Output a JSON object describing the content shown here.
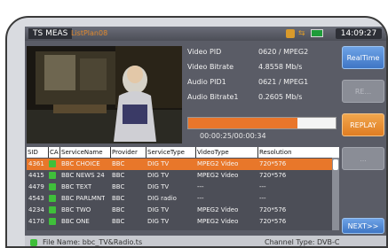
{
  "topbar": {
    "meas_tab": "TS MEAS",
    "list_tab": "ListPlan08",
    "clock": "14:09:27",
    "icons": [
      "satellite-signal-icon",
      "network-icon",
      "battery-icon"
    ]
  },
  "info": {
    "rows": [
      {
        "label": "Video PID",
        "value": "0620 / MPEG2"
      },
      {
        "label": "Video Bitrate",
        "value": "4.8558 Mb/s"
      },
      {
        "label": "Audio PID1",
        "value": "0621 / MPEG1"
      },
      {
        "label": "Audio Bitrate1",
        "value": "0.2605 Mb/s"
      }
    ]
  },
  "playback": {
    "time": "00:00:25/00:00:34",
    "progress_fraction": 0.74
  },
  "side_buttons": {
    "realtime": "RealTime",
    "disabled1": "RE...",
    "replay": "REPLAY",
    "disabled2": "..."
  },
  "table": {
    "columns": [
      "SID",
      "CA",
      "ServiceName",
      "Provider",
      "ServiceType",
      "VideoType",
      "Resolution"
    ],
    "rows": [
      {
        "sid": "4361",
        "service": "BBC CHOICE",
        "provider": "BBC",
        "type": "DIG TV",
        "video": "MPEG2 Video",
        "res": "720*576",
        "selected": true
      },
      {
        "sid": "4415",
        "service": "BBC NEWS 24",
        "provider": "BBC",
        "type": "DIG TV",
        "video": "MPEG2 Video",
        "res": "720*576",
        "selected": false
      },
      {
        "sid": "4479",
        "service": "BBC TEXT",
        "provider": "BBC",
        "type": "DIG TV",
        "video": "---",
        "res": "---",
        "selected": false
      },
      {
        "sid": "4543",
        "service": "BBC PARLMNT",
        "provider": "BBC",
        "type": "DIG radio",
        "video": "---",
        "res": "---",
        "selected": false
      },
      {
        "sid": "4234",
        "service": "BBC TWO",
        "provider": "BBC",
        "type": "DIG TV",
        "video": "MPEG2 Video",
        "res": "720*576",
        "selected": false
      },
      {
        "sid": "4170",
        "service": "BBC ONE",
        "provider": "BBC",
        "type": "DIG TV",
        "video": "MPEG2 Video",
        "res": "720*576",
        "selected": false
      }
    ]
  },
  "next_label": "NEXT>>",
  "footer": {
    "file_name": "File Name: bbc_TV&Radio.ts",
    "channel_type": "Channel Type: DVB-C"
  },
  "colors": {
    "accent_orange": "#e8772a",
    "button_blue": "#3f76c5",
    "lock_green": "#3fbf3a"
  }
}
